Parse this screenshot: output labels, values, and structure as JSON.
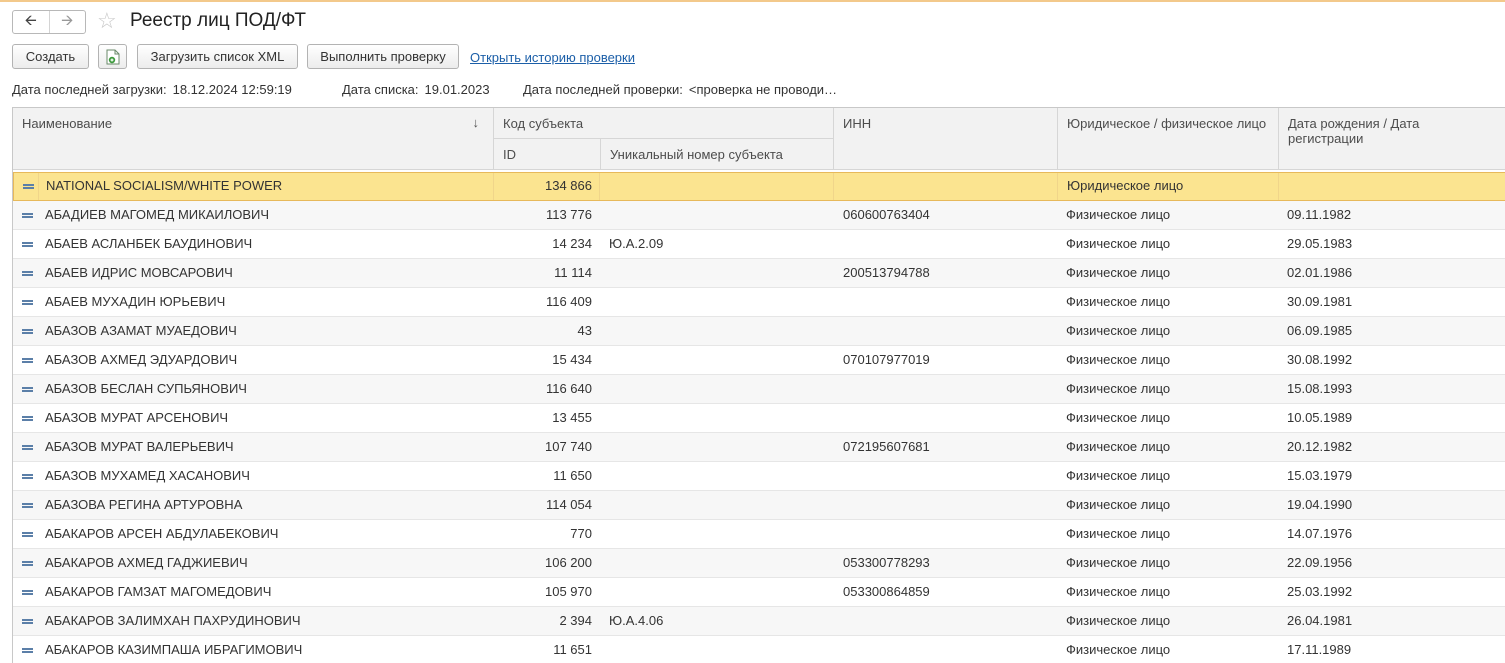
{
  "window": {
    "title": "Реестр лиц ПОД/ФТ"
  },
  "toolbar": {
    "create_label": "Создать",
    "load_label": "Загрузить список XML",
    "check_label": "Выполнить проверку",
    "history_link": "Открыть историю проверки"
  },
  "info": {
    "last_load_label": "Дата последней загрузки:",
    "last_load_value": "18.12.2024 12:59:19",
    "list_date_label": "Дата списка:",
    "list_date_value": "19.01.2023",
    "last_check_label": "Дата последней проверки:",
    "last_check_value": "<проверка не проводи…"
  },
  "table": {
    "columns": {
      "name": "Наименование",
      "subject_code": "Код субъекта",
      "id": "ID",
      "unique_number": "Уникальный номер субъекта",
      "inn": "ИНН",
      "type": "Юридическое / физическое лицо",
      "date": "Дата рождения / Дата регистрации"
    },
    "rows": [
      {
        "name": "NATIONAL SOCIALISM/WHITE POWER",
        "id": "134 866",
        "uniq": "",
        "inn": "",
        "type": "Юридическое лицо",
        "date": ""
      },
      {
        "name": "АБАДИЕВ МАГОМЕД МИКАИЛОВИЧ",
        "id": "113 776",
        "uniq": "",
        "inn": "060600763404",
        "type": "Физическое лицо",
        "date": "09.11.1982"
      },
      {
        "name": "АБАЕВ АСЛАНБЕК БАУДИНОВИЧ",
        "id": "14 234",
        "uniq": "Ю.А.2.09",
        "inn": "",
        "type": "Физическое лицо",
        "date": "29.05.1983"
      },
      {
        "name": "АБАЕВ ИДРИС МОВСАРОВИЧ",
        "id": "11 114",
        "uniq": "",
        "inn": "200513794788",
        "type": "Физическое лицо",
        "date": "02.01.1986"
      },
      {
        "name": "АБАЕВ МУХАДИН ЮРЬЕВИЧ",
        "id": "116 409",
        "uniq": "",
        "inn": "",
        "type": "Физическое лицо",
        "date": "30.09.1981"
      },
      {
        "name": "АБАЗОВ АЗАМАТ МУАЕДОВИЧ",
        "id": "43",
        "uniq": "",
        "inn": "",
        "type": "Физическое лицо",
        "date": "06.09.1985"
      },
      {
        "name": "АБАЗОВ АХМЕД ЭДУАРДОВИЧ",
        "id": "15 434",
        "uniq": "",
        "inn": "070107977019",
        "type": "Физическое лицо",
        "date": "30.08.1992"
      },
      {
        "name": "АБАЗОВ БЕСЛАН СУПЬЯНОВИЧ",
        "id": "116 640",
        "uniq": "",
        "inn": "",
        "type": "Физическое лицо",
        "date": "15.08.1993"
      },
      {
        "name": "АБАЗОВ МУРАТ АРСЕНОВИЧ",
        "id": "13 455",
        "uniq": "",
        "inn": "",
        "type": "Физическое лицо",
        "date": "10.05.1989"
      },
      {
        "name": "АБАЗОВ МУРАТ ВАЛЕРЬЕВИЧ",
        "id": "107 740",
        "uniq": "",
        "inn": "072195607681",
        "type": "Физическое лицо",
        "date": "20.12.1982"
      },
      {
        "name": "АБАЗОВ МУХАМЕД ХАСАНОВИЧ",
        "id": "11 650",
        "uniq": "",
        "inn": "",
        "type": "Физическое лицо",
        "date": "15.03.1979"
      },
      {
        "name": "АБАЗОВА РЕГИНА АРТУРОВНА",
        "id": "114 054",
        "uniq": "",
        "inn": "",
        "type": "Физическое лицо",
        "date": "19.04.1990"
      },
      {
        "name": "АБАКАРОВ АРСЕН АБДУЛАБЕКОВИЧ",
        "id": "770",
        "uniq": "",
        "inn": "",
        "type": "Физическое лицо",
        "date": "14.07.1976"
      },
      {
        "name": "АБАКАРОВ АХМЕД ГАДЖИЕВИЧ",
        "id": "106 200",
        "uniq": "",
        "inn": "053300778293",
        "type": "Физическое лицо",
        "date": "22.09.1956"
      },
      {
        "name": "АБАКАРОВ ГАМЗАТ МАГОМЕДОВИЧ",
        "id": "105 970",
        "uniq": "",
        "inn": "053300864859",
        "type": "Физическое лицо",
        "date": "25.03.1992"
      },
      {
        "name": "АБАКАРОВ ЗАЛИМХАН ПАХРУДИНОВИЧ",
        "id": "2 394",
        "uniq": "Ю.А.4.06",
        "inn": "",
        "type": "Физическое лицо",
        "date": "26.04.1981"
      },
      {
        "name": "АБАКАРОВ КАЗИМПАША ИБРАГИМОВИЧ",
        "id": "11 651",
        "uniq": "",
        "inn": "",
        "type": "Физическое лицо",
        "date": "17.11.1989"
      }
    ]
  }
}
